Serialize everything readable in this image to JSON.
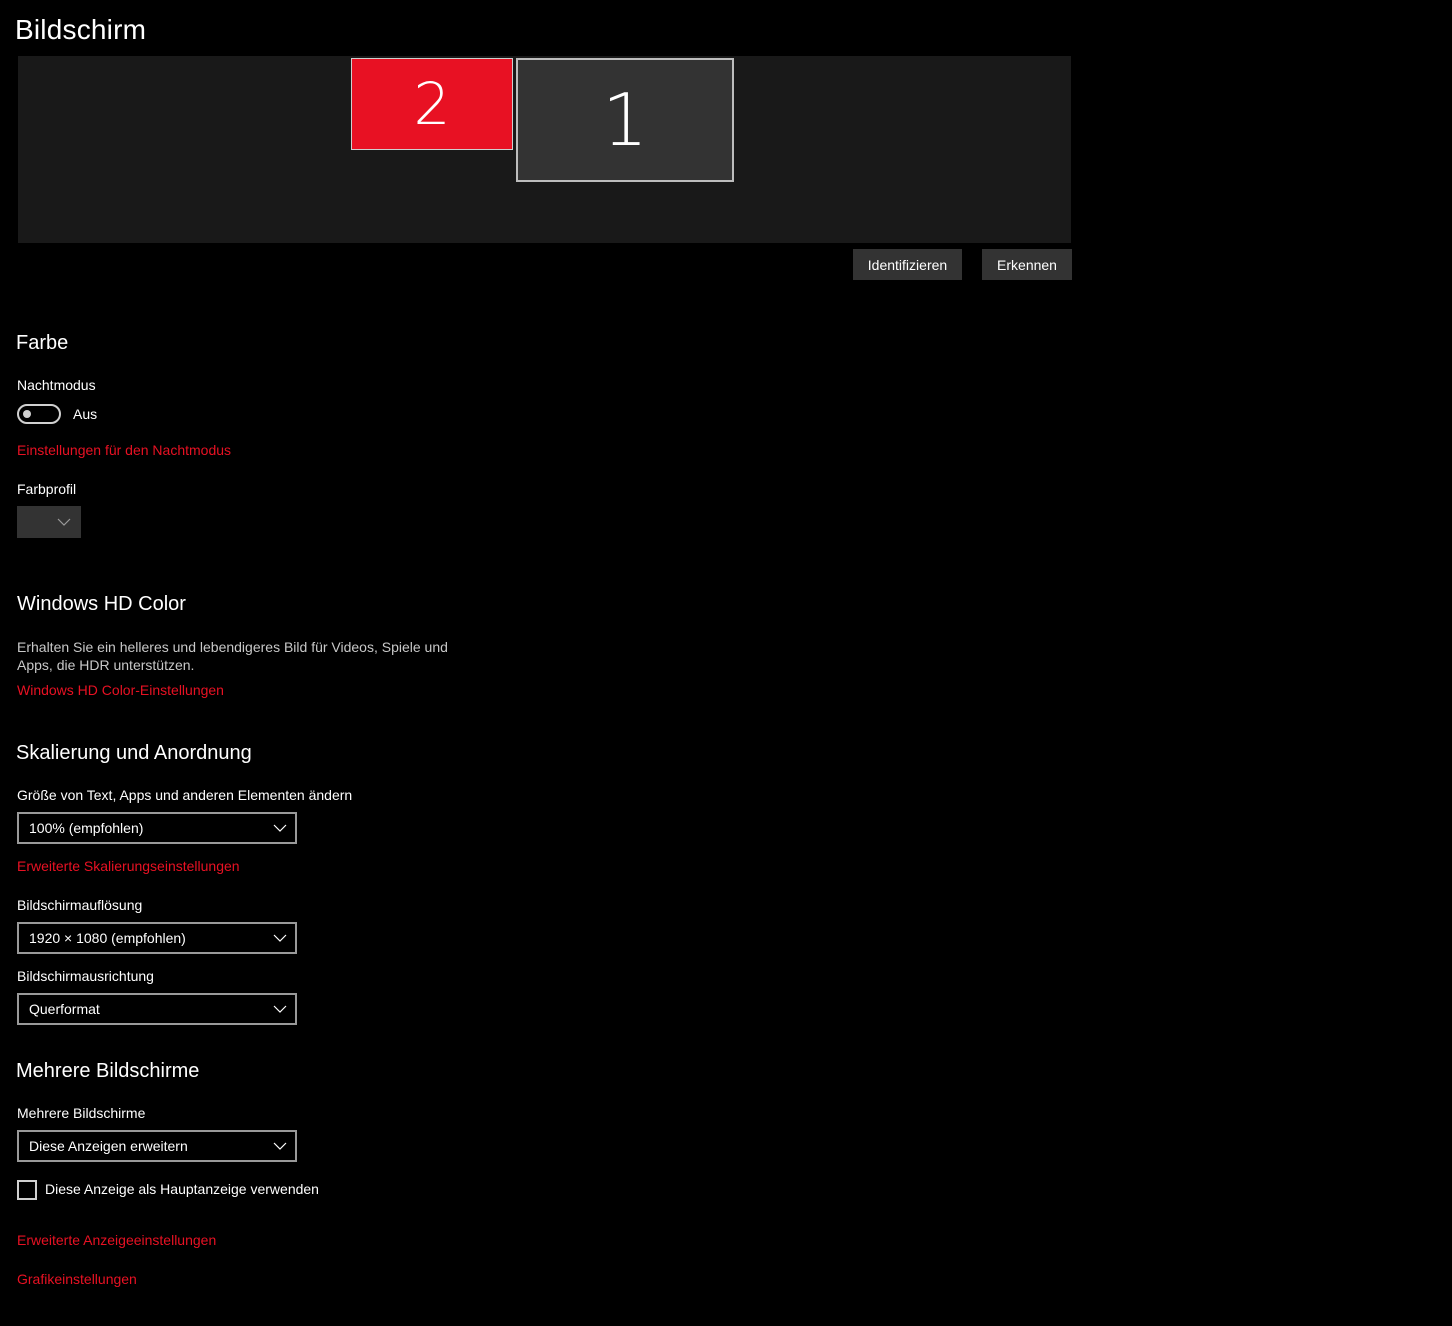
{
  "page": {
    "title": "Bildschirm"
  },
  "arrangement": {
    "monitors": [
      {
        "number": "2",
        "selected": true
      },
      {
        "number": "1",
        "selected": false
      }
    ],
    "identify_label": "Identifizieren",
    "detect_label": "Erkennen"
  },
  "color": {
    "section_title": "Farbe",
    "night_mode_label": "Nachtmodus",
    "night_mode_state": "Aus",
    "night_mode_settings_link": "Einstellungen für den Nachtmodus",
    "color_profile_label": "Farbprofil",
    "color_profile_value": ""
  },
  "hd_color": {
    "section_title": "Windows HD Color",
    "description": "Erhalten Sie ein helleres und lebendigeres Bild für Videos, Spiele und Apps, die HDR unterstützen.",
    "settings_link": "Windows HD Color-Einstellungen"
  },
  "scaling": {
    "section_title": "Skalierung und Anordnung",
    "size_label": "Größe von Text, Apps und anderen Elementen ändern",
    "size_value": "100% (empfohlen)",
    "advanced_scaling_link": "Erweiterte Skalierungseinstellungen",
    "resolution_label": "Bildschirmauflösung",
    "resolution_value": "1920 × 1080 (empfohlen)",
    "orientation_label": "Bildschirmausrichtung",
    "orientation_value": "Querformat"
  },
  "multiple": {
    "section_title": "Mehrere Bildschirme",
    "label": "Mehrere Bildschirme",
    "value": "Diese Anzeigen erweitern",
    "main_display_checkbox_label": "Diese Anzeige als Hauptanzeige verwenden",
    "main_display_checked": false
  },
  "links": {
    "advanced_display": "Erweiterte Anzeigeeinstellungen",
    "graphics": "Grafikeinstellungen"
  },
  "colors": {
    "background": "#000000",
    "accent": "#e81123",
    "button_bg": "#333333",
    "arrange_bg": "#191919"
  }
}
